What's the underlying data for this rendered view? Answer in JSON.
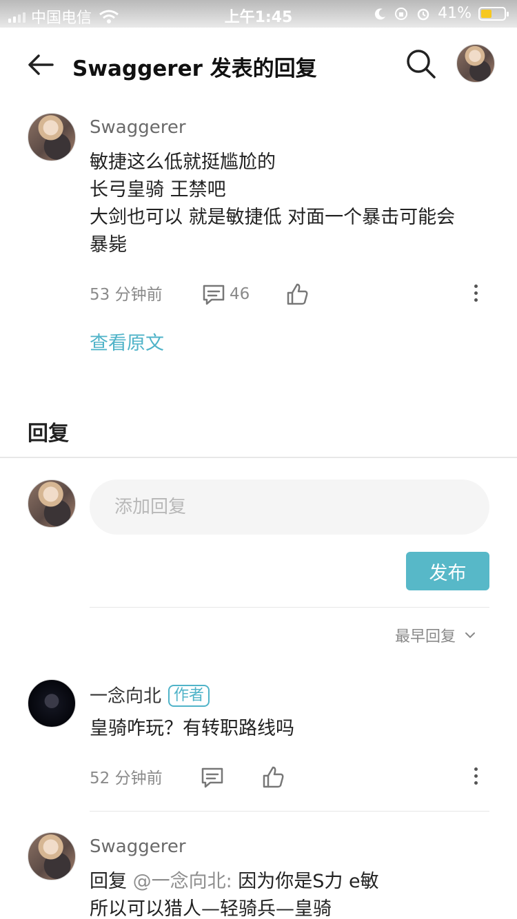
{
  "status_bar": {
    "carrier": "中国电信",
    "time": "上午1:45",
    "battery": "41%",
    "battery_level": 0.41
  },
  "header": {
    "title": "Swaggerer 发表的回复",
    "back_icon": "arrow-left-icon",
    "search_icon": "search-icon"
  },
  "original_post": {
    "username": "Swaggerer",
    "lines": [
      "敏捷这么低就挺尴尬的",
      "长弓皇骑 王禁吧",
      "大剑也可以 就是敏捷低 对面一个暴击可能会",
      "暴毙"
    ],
    "time": "53 分钟前",
    "comment_count": "46",
    "view_original": "查看原文"
  },
  "replies_section": {
    "title": "回复",
    "input_placeholder": "添加回复",
    "publish_label": "发布",
    "sort_label": "最早回复"
  },
  "replies": [
    {
      "username": "一念向北",
      "badge": "作者",
      "content": "皇骑咋玩？有转职路线吗",
      "time": "52 分钟前"
    },
    {
      "username": "Swaggerer",
      "prefix": "回复",
      "mention": "@一念向北:",
      "line1": "因为你是S力 e敏",
      "line2": "所以可以猎人—轻骑兵—皇骑"
    }
  ],
  "colors": {
    "accent": "#57b8c8",
    "link": "#4fb3c8"
  }
}
